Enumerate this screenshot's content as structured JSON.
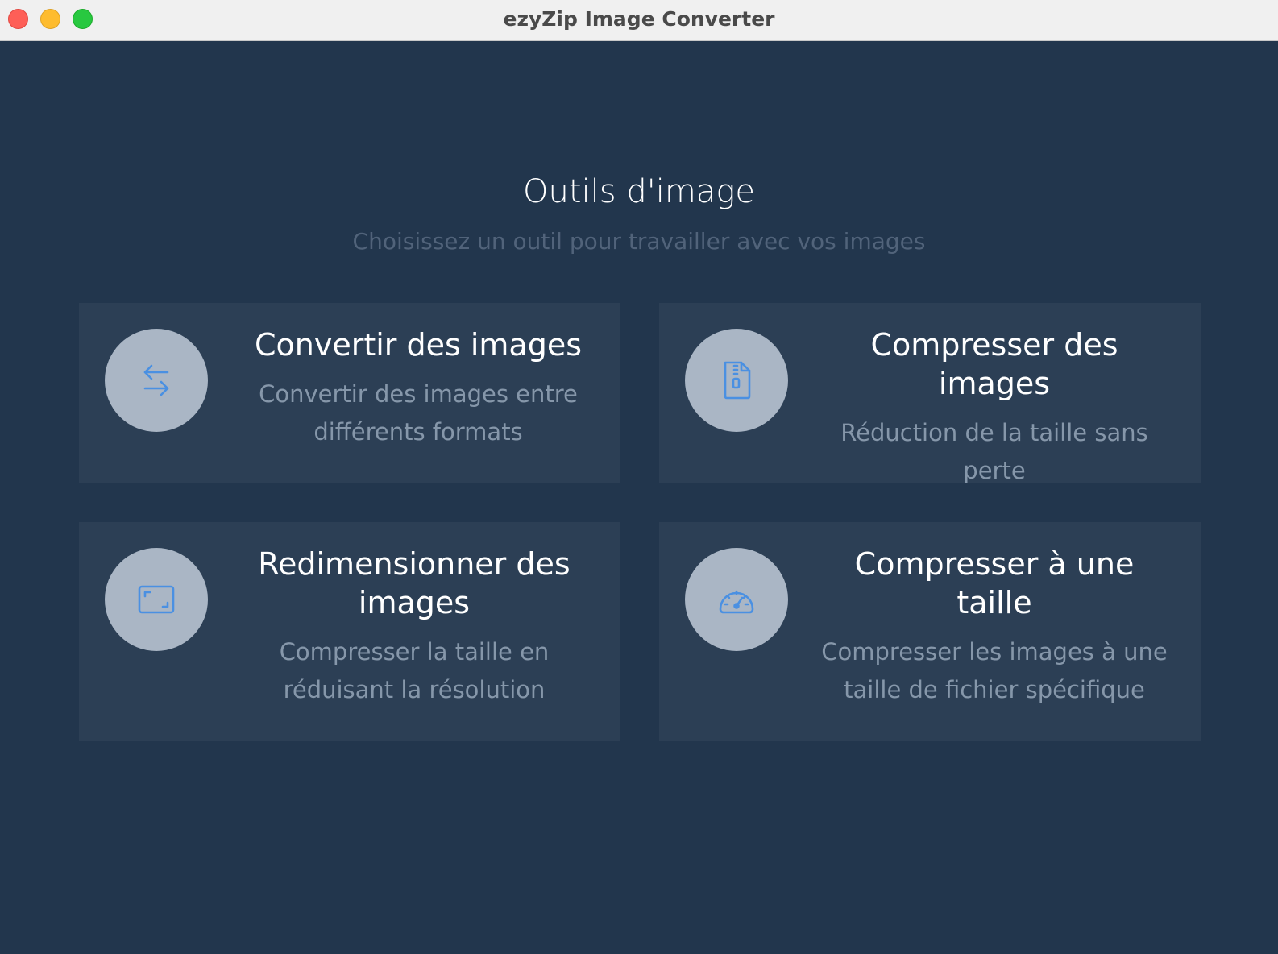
{
  "window": {
    "title": "ezyZip Image Converter"
  },
  "page": {
    "title": "Outils d'image",
    "subtitle": "Choisissez un outil pour travailler avec vos images"
  },
  "tools": [
    {
      "title": "Convertir des images",
      "description": "Convertir des images entre différents formats",
      "icon": "swap-arrows-icon"
    },
    {
      "title": "Compresser des images",
      "description": "Réduction de la taille sans perte",
      "icon": "zip-file-icon"
    },
    {
      "title": "Redimensionner des images",
      "description": "Compresser la taille en réduisant la résolution",
      "icon": "resize-frame-icon"
    },
    {
      "title": "Compresser à une taille",
      "description": "Compresser les images à une taille de fichier spécifique",
      "icon": "speedometer-icon"
    }
  ],
  "colors": {
    "background": "#22364d",
    "card": "#2c3f55",
    "icon_circle": "#aab6c5",
    "icon_stroke": "#4a90e2",
    "title_text": "#ffffff",
    "description_text": "#8697aa",
    "subtitle_text": "#51637a"
  }
}
